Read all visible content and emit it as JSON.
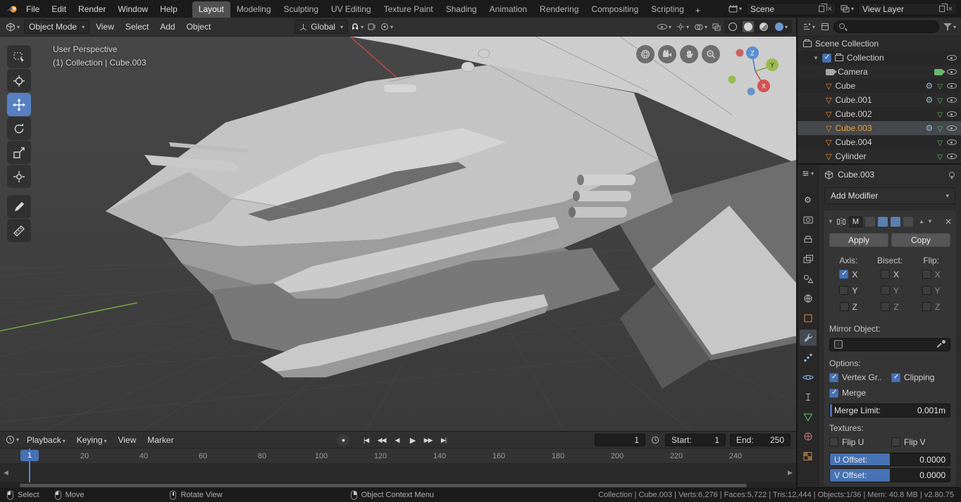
{
  "topbar": {
    "app_menus": [
      "File",
      "Edit",
      "Render",
      "Window",
      "Help"
    ],
    "workspace_tabs": [
      {
        "label": "Layout",
        "active": true
      },
      {
        "label": "Modeling",
        "active": false
      },
      {
        "label": "Sculpting",
        "active": false
      },
      {
        "label": "UV Editing",
        "active": false
      },
      {
        "label": "Texture Paint",
        "active": false
      },
      {
        "label": "Shading",
        "active": false
      },
      {
        "label": "Animation",
        "active": false
      },
      {
        "label": "Rendering",
        "active": false
      },
      {
        "label": "Compositing",
        "active": false
      },
      {
        "label": "Scripting",
        "active": false
      }
    ],
    "add_tab_label": "+",
    "scene_field": "Scene",
    "view_layer_field": "View Layer"
  },
  "viewport_header": {
    "mode": "Object Mode",
    "menus": [
      "View",
      "Select",
      "Add",
      "Object"
    ],
    "orientation": "Global"
  },
  "viewport": {
    "perspective_label": "User Perspective",
    "context_label": "(1) Collection | Cube.003",
    "axis_x": "X",
    "axis_y": "Y",
    "axis_z": "Z"
  },
  "outliner": {
    "scene_collection_label": "Scene Collection",
    "items": [
      {
        "label": "Collection",
        "selected": false
      },
      {
        "label": "Camera",
        "selected": false
      },
      {
        "label": "Cube",
        "selected": false
      },
      {
        "label": "Cube.001",
        "selected": false
      },
      {
        "label": "Cube.002",
        "selected": false
      },
      {
        "label": "Cube.003",
        "selected": true
      },
      {
        "label": "Cube.004",
        "selected": false
      },
      {
        "label": "Cylinder",
        "selected": false
      }
    ]
  },
  "properties": {
    "breadcrumb": "Cube.003",
    "add_modifier_label": "Add Modifier",
    "modifier": {
      "name_short": "M",
      "apply_label": "Apply",
      "copy_label": "Copy",
      "axis_label": "Axis:",
      "bisect_label": "Bisect:",
      "flip_label": "Flip:",
      "x": "X",
      "y": "Y",
      "z": "Z",
      "checked": {
        "axis_x": true,
        "vertex_groups": true,
        "clipping": true,
        "merge": true
      },
      "mirror_object_label": "Mirror Object:",
      "options_label": "Options:",
      "vertex_groups_label": "Vertex Gr..",
      "clipping_label": "Clipping",
      "merge_label": "Merge",
      "merge_limit_label": "Merge Limit:",
      "merge_limit_value": "0.001m",
      "textures_label": "Textures:",
      "flip_u_label": "Flip U",
      "flip_v_label": "Flip V",
      "u_offset_label": "U Offset:",
      "u_offset_value": "0.0000",
      "v_offset_label": "V Offset:",
      "v_offset_value": "0.0000"
    }
  },
  "timeline": {
    "menus": [
      "Playback",
      "Keying",
      "View",
      "Marker"
    ],
    "current_frame": "1",
    "playhead_label": "1",
    "start_label": "Start:",
    "start_value": "1",
    "end_label": "End:",
    "end_value": "250",
    "ticks": [
      "20",
      "40",
      "60",
      "80",
      "100",
      "120",
      "140",
      "160",
      "180",
      "200",
      "220",
      "240"
    ]
  },
  "statusbar": {
    "select_label": "Select",
    "move_label": "Move",
    "rotate_label": "Rotate View",
    "context_label": "Object Context Menu",
    "stats": "Collection | Cube.003 | Verts:6,276 | Faces:5,722 | Tris:12,444 | Objects:1/36 | Mem: 40.8 MB | v2.80.75"
  },
  "colors": {
    "accent": "#4772b3",
    "selection_orange": "#eca135"
  }
}
